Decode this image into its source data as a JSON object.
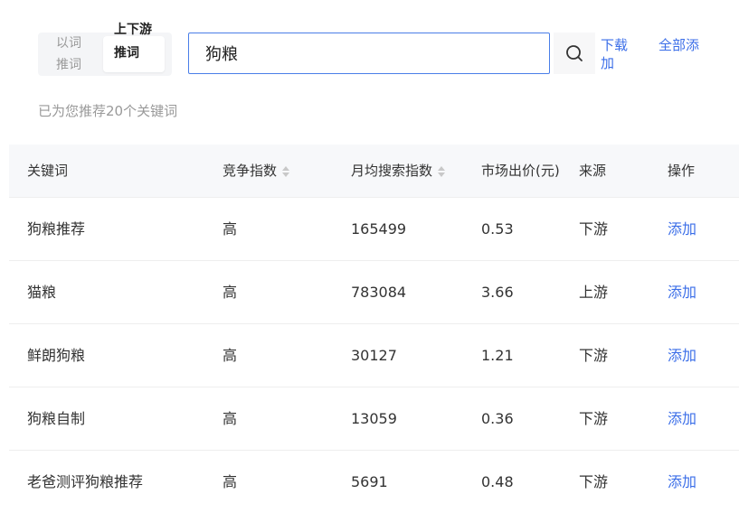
{
  "toolbar": {
    "segment": {
      "inactive_label": "以词推词",
      "active_label": "上下游推词"
    },
    "search": {
      "value": "狗粮"
    },
    "search_icon": "search-icon",
    "download_label": "下载",
    "download_label_2": "加",
    "add_all_label": "全部添",
    "hint": "已为您推荐20个关键词"
  },
  "table": {
    "headers": {
      "keyword": "关键词",
      "competition": "竞争指数",
      "monthly_search": "月均搜索指数",
      "bid": "市场出价(元)",
      "source": "来源",
      "action": "操作"
    },
    "rows": [
      {
        "keyword": "狗粮推荐",
        "competition": "高",
        "monthly_search": "165499",
        "bid": "0.53",
        "source": "下游",
        "action": "添加"
      },
      {
        "keyword": "猫粮",
        "competition": "高",
        "monthly_search": "783084",
        "bid": "3.66",
        "source": "上游",
        "action": "添加"
      },
      {
        "keyword": "鲜朗狗粮",
        "competition": "高",
        "monthly_search": "30127",
        "bid": "1.21",
        "source": "下游",
        "action": "添加"
      },
      {
        "keyword": "狗粮自制",
        "competition": "高",
        "monthly_search": "13059",
        "bid": "0.36",
        "source": "下游",
        "action": "添加"
      },
      {
        "keyword": "老爸测评狗粮推荐",
        "competition": "高",
        "monthly_search": "5691",
        "bid": "0.48",
        "source": "下游",
        "action": "添加"
      }
    ]
  }
}
